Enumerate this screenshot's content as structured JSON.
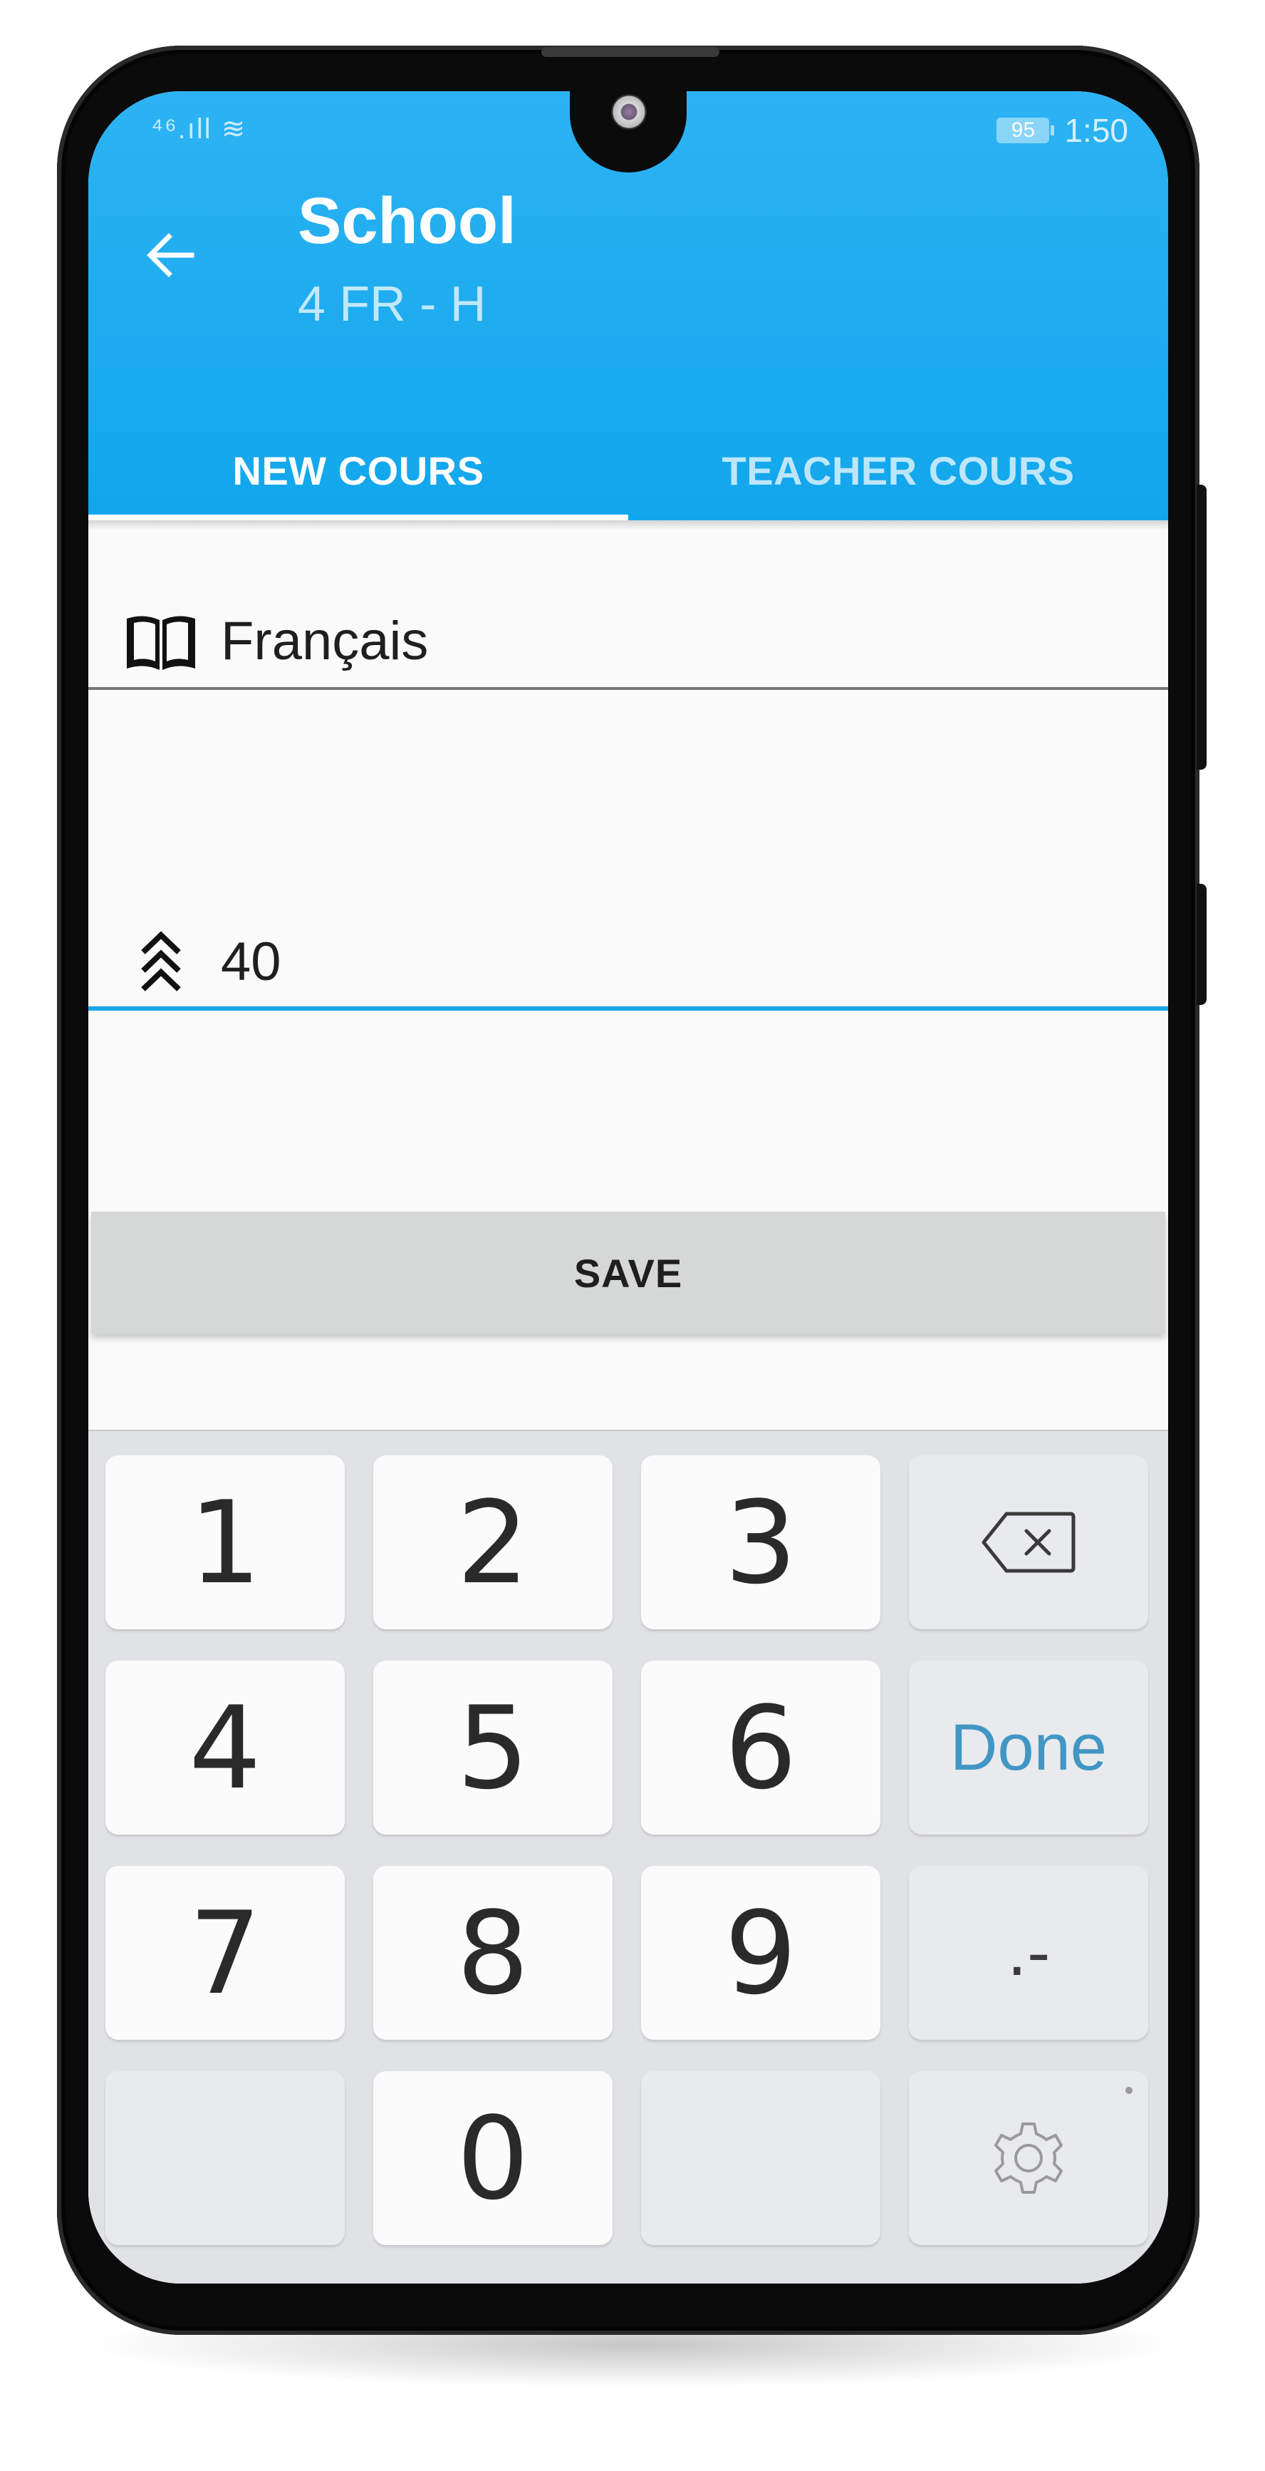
{
  "status_bar": {
    "left": "⁴⁶.ıll ≋",
    "battery": "95",
    "time": "1:50"
  },
  "app_bar": {
    "title": "School",
    "subtitle": "4 FR - H"
  },
  "tabs": [
    {
      "label": "NEW COURS",
      "selected": true
    },
    {
      "label": "TEACHER COURS",
      "selected": false
    }
  ],
  "form": {
    "subject": {
      "value": "Français",
      "icon": "book-icon"
    },
    "hours": {
      "value": "40",
      "icon": "triple-chevron-up-icon"
    },
    "save_label": "SAVE"
  },
  "keyboard": {
    "keys": {
      "k1": "1",
      "k2": "2",
      "k3": "3",
      "k4": "4",
      "k5": "5",
      "k6": "6",
      "k7": "7",
      "k8": "8",
      "k9": "9",
      "k0": "0",
      "done": "Done",
      "dot_dash": ".-"
    },
    "icons": {
      "backspace": "backspace-icon",
      "settings": "gear-icon"
    }
  },
  "colors": {
    "app_bar": "#1aa6ec",
    "active_field_underline": "#1aa6e4",
    "done_key": "#4196c4"
  }
}
